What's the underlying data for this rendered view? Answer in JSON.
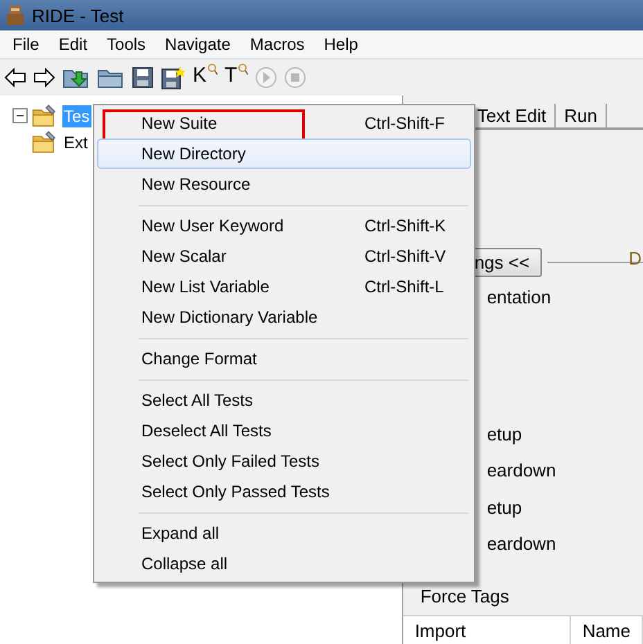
{
  "window": {
    "title": "RIDE - Test"
  },
  "menubar": [
    "File",
    "Edit",
    "Tools",
    "Navigate",
    "Macros",
    "Help"
  ],
  "toolbar": [
    {
      "kind": "back"
    },
    {
      "kind": "forward"
    },
    {
      "kind": "open-folder"
    },
    {
      "kind": "folder"
    },
    {
      "kind": "save"
    },
    {
      "kind": "save-all"
    },
    {
      "kind": "search-letter",
      "label": "K"
    },
    {
      "kind": "search-letter",
      "label": "T"
    },
    {
      "kind": "run",
      "disabled": true
    },
    {
      "kind": "stop",
      "disabled": true
    }
  ],
  "tree": [
    {
      "label": "Tes",
      "selected": true,
      "expanded": true,
      "children": [
        {
          "label": "Ext",
          "selected": false
        }
      ]
    }
  ],
  "tabs": [
    {
      "label": "Text Edit",
      "selected": false
    },
    {
      "label": "Run",
      "selected": false
    }
  ],
  "right_panel": {
    "corner_text": "D",
    "settings_button": "ngs <<",
    "fields": [
      "entation",
      "etup",
      "eardown",
      "etup",
      "eardown"
    ],
    "force_tags_label": "Force Tags",
    "table_columns": [
      "Import",
      "Name"
    ]
  },
  "context_menu": [
    {
      "kind": "item",
      "label": "New Suite",
      "shortcut": "Ctrl-Shift-F",
      "highlighted": false,
      "annotated": true
    },
    {
      "kind": "item",
      "label": "New Directory",
      "highlighted": true,
      "annotated": false
    },
    {
      "kind": "item",
      "label": "New Resource",
      "highlighted": false,
      "annotated": false
    },
    {
      "kind": "separator"
    },
    {
      "kind": "item",
      "label": "New User Keyword",
      "shortcut": "Ctrl-Shift-K",
      "highlighted": false,
      "annotated": false
    },
    {
      "kind": "item",
      "label": "New Scalar",
      "shortcut": "Ctrl-Shift-V",
      "highlighted": false,
      "annotated": false
    },
    {
      "kind": "item",
      "label": "New List Variable",
      "shortcut": "Ctrl-Shift-L",
      "highlighted": false,
      "annotated": false
    },
    {
      "kind": "item",
      "label": "New Dictionary Variable",
      "highlighted": false,
      "annotated": false
    },
    {
      "kind": "separator"
    },
    {
      "kind": "item",
      "label": "Change Format",
      "highlighted": false,
      "annotated": false
    },
    {
      "kind": "separator"
    },
    {
      "kind": "item",
      "label": "Select All Tests",
      "highlighted": false,
      "annotated": false
    },
    {
      "kind": "item",
      "label": "Deselect All Tests",
      "highlighted": false,
      "annotated": false
    },
    {
      "kind": "item",
      "label": "Select Only Failed Tests",
      "highlighted": false,
      "annotated": false
    },
    {
      "kind": "item",
      "label": "Select Only Passed Tests",
      "highlighted": false,
      "annotated": false
    },
    {
      "kind": "separator"
    },
    {
      "kind": "item",
      "label": "Expand all",
      "highlighted": false,
      "annotated": false
    },
    {
      "kind": "item",
      "label": "Collapse all",
      "highlighted": false,
      "annotated": false
    }
  ]
}
